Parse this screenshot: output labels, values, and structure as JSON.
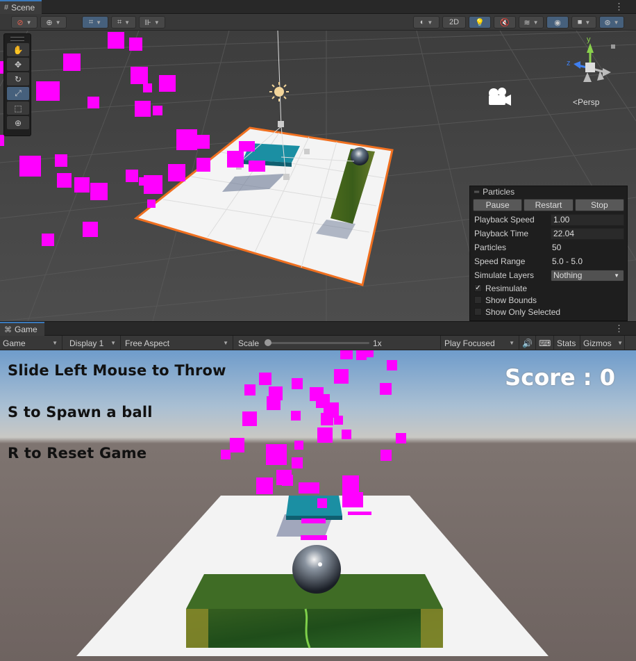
{
  "scene_tab": {
    "label": "Scene",
    "icon": "grid-icon"
  },
  "scene_toolbar": {
    "twod_label": "2D",
    "icons": [
      "draw-mode-icon",
      "global-icon",
      "grid-snap-icon",
      "increment-snap-icon",
      "ruler-icon",
      "shading-mode-icon",
      "lighting-icon",
      "audio-mute-icon",
      "effects-icon",
      "visibility-icon",
      "camera-icon",
      "gizmos-icon"
    ]
  },
  "tools": [
    "hand-tool-icon",
    "move-tool-icon",
    "rotate-tool-icon",
    "scale-tool-icon",
    "rect-tool-icon",
    "transform-tool-icon"
  ],
  "gizmo": {
    "y": "y",
    "z": "z",
    "persp_label": "Persp"
  },
  "particles_panel": {
    "title": "Particles",
    "pause_label": "Pause",
    "restart_label": "Restart",
    "stop_label": "Stop",
    "playback_speed_label": "Playback Speed",
    "playback_speed": "1.00",
    "playback_time_label": "Playback Time",
    "playback_time": "22.04",
    "particles_label": "Particles",
    "particles_count": "50",
    "speed_range_label": "Speed Range",
    "speed_range": "5.0 - 5.0",
    "simulate_layers_label": "Simulate Layers",
    "simulate_layers": "Nothing",
    "resimulate_label": "Resimulate",
    "resimulate_checked": true,
    "show_bounds_label": "Show Bounds",
    "show_only_selected_label": "Show Only Selected"
  },
  "game_tab": {
    "label": "Game",
    "icon": "gamepad-icon"
  },
  "game_toolbar": {
    "mode": "Game",
    "display": "Display 1",
    "aspect": "Free Aspect",
    "scale_label": "Scale",
    "scale_value": "1x",
    "play_mode": "Play Focused",
    "stats_label": "Stats",
    "gizmos_label": "Gizmos"
  },
  "game_ui": {
    "line1": "Slide Left Mouse to Throw",
    "line2": "S to Spawn a ball",
    "line3": "R to Reset Game",
    "score": "Score : 0"
  },
  "colors": {
    "particle": "#ff00ff",
    "platform": "#1b8fa3",
    "selection": "#f07020",
    "accent": "#3a79bb"
  }
}
